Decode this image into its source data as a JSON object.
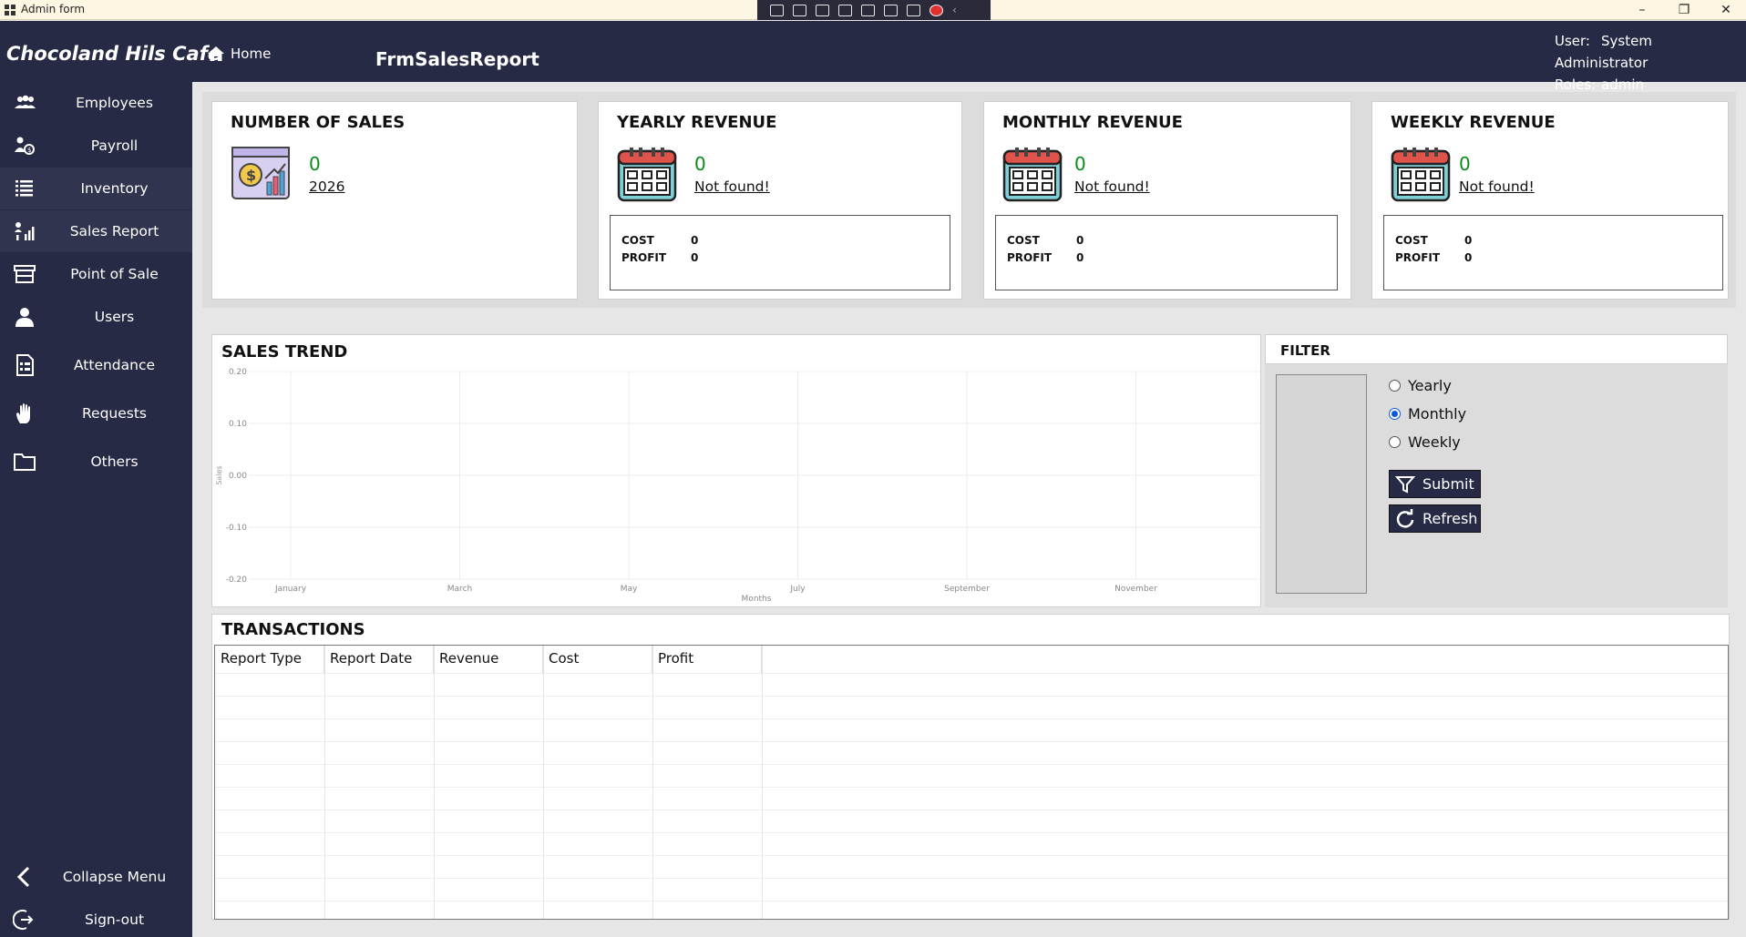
{
  "window": {
    "title": "Admin form",
    "min_glyph": "–",
    "restore_glyph": "❐",
    "close_glyph": "✕"
  },
  "header": {
    "brand": "Chocoland Hils Cafe",
    "home_label": "Home",
    "form_title": "FrmSalesReport",
    "user_label": "User:",
    "user_value": "System Administrator",
    "roles_label": "Roles:",
    "roles_value": "admin"
  },
  "sidebar": {
    "items": [
      {
        "label": "Employees",
        "icon": "people-icon"
      },
      {
        "label": "Payroll",
        "icon": "payroll-icon"
      },
      {
        "label": "Inventory",
        "icon": "list-icon"
      },
      {
        "label": "Sales Report",
        "icon": "report-chart-icon"
      },
      {
        "label": "Point of Sale",
        "icon": "store-icon"
      },
      {
        "label": "Users",
        "icon": "user-icon"
      },
      {
        "label": "Attendance",
        "icon": "attendance-sheet-icon"
      },
      {
        "label": "Requests",
        "icon": "hand-icon"
      },
      {
        "label": "Others",
        "icon": "folder-icon"
      }
    ],
    "active_index": 3,
    "collapse_label": "Collapse Menu",
    "signout_label": "Sign-out"
  },
  "cards": {
    "number_of_sales": {
      "title": "NUMBER OF SALES",
      "value": "0",
      "sub": "2026"
    },
    "yearly": {
      "title": "YEARLY REVENUE",
      "value": "0",
      "sub": "Not found!",
      "cost_label": "COST",
      "cost": "0",
      "profit_label": "PROFIT",
      "profit": "0"
    },
    "monthly": {
      "title": "MONTHLY REVENUE",
      "value": "0",
      "sub": "Not found!",
      "cost_label": "COST",
      "cost": "0",
      "profit_label": "PROFIT",
      "profit": "0"
    },
    "weekly": {
      "title": "WEEKLY REVENUE",
      "value": "0",
      "sub": "Not found!",
      "cost_label": "COST",
      "cost": "0",
      "profit_label": "PROFIT",
      "profit": "0"
    }
  },
  "trend": {
    "title": "SALES TREND"
  },
  "chart_data": {
    "type": "line",
    "title": "SALES TREND",
    "xlabel": "Months",
    "ylabel": "Sales",
    "x_ticks": [
      "January",
      "March",
      "May",
      "July",
      "September",
      "November"
    ],
    "y_ticks": [
      "0.20",
      "0.10",
      "0.00",
      "-0.10",
      "-0.20"
    ],
    "ylim": [
      -0.2,
      0.2
    ],
    "grid": true,
    "series": []
  },
  "filter": {
    "title": "FILTER",
    "options": [
      "Yearly",
      "Monthly",
      "Weekly"
    ],
    "selected": "Monthly",
    "submit_label": "Submit",
    "refresh_label": "Refresh"
  },
  "transactions": {
    "title": "TRANSACTIONS",
    "columns": [
      "Report Type",
      "Report Date",
      "Revenue",
      "Cost",
      "Profit"
    ],
    "rows": []
  }
}
